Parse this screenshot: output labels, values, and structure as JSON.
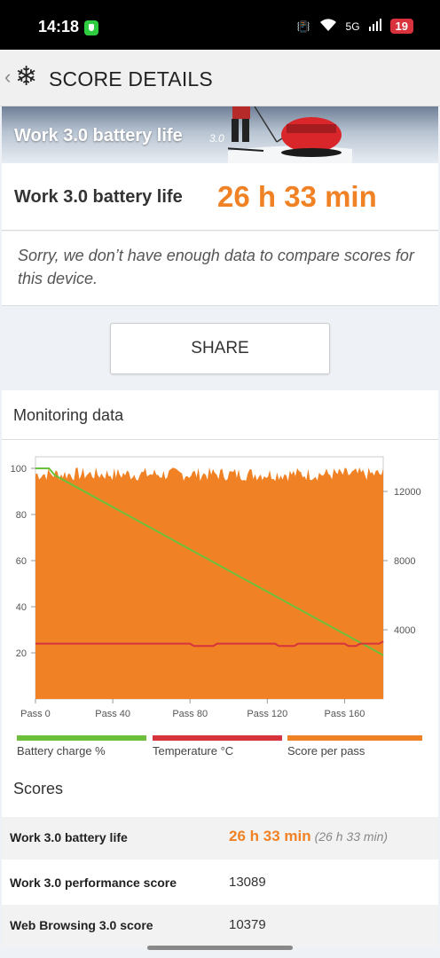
{
  "status_bar": {
    "time": "14:18",
    "signal_label": "5G",
    "battery": "19"
  },
  "header": {
    "title": "SCORE DETAILS"
  },
  "banner": {
    "title": "Work 3.0 battery life",
    "version": "3.0"
  },
  "score": {
    "label": "Work 3.0 battery life",
    "value": "26 h 33 min"
  },
  "notice": {
    "text": "Sorry, we don’t have enough data to compare scores for this device."
  },
  "share_button": {
    "label": "SHARE"
  },
  "monitoring": {
    "title": "Monitoring data"
  },
  "chart_data": {
    "type": "area",
    "x_ticks": [
      "Pass 0",
      "Pass 40",
      "Pass 80",
      "Pass 120",
      "Pass 160"
    ],
    "x_range": [
      0,
      180
    ],
    "left_axis": {
      "ticks": [
        20,
        40,
        60,
        80,
        100
      ],
      "range": [
        0,
        105
      ]
    },
    "right_axis": {
      "ticks": [
        4000,
        8000,
        12000
      ],
      "range": [
        0,
        14000
      ]
    },
    "series": [
      {
        "name": "Battery charge %",
        "color": "#6cbf3b",
        "axis": "left",
        "x": [
          0,
          7,
          10,
          180
        ],
        "y": [
          100,
          100,
          97,
          19
        ]
      },
      {
        "name": "Temperature °C",
        "color": "#d6333d",
        "axis": "left",
        "x": [
          0,
          80,
          82,
          92,
          94,
          104,
          106,
          124,
          126,
          134,
          136,
          160,
          162,
          166,
          168,
          178,
          180
        ],
        "y": [
          24,
          24,
          23,
          23,
          24,
          24,
          24,
          24,
          23,
          23,
          24,
          24,
          23,
          23,
          24,
          24,
          25
        ]
      },
      {
        "name": "Score per pass",
        "color": "#f08225",
        "axis": "right",
        "x_range": [
          0,
          180
        ],
        "mean": 12900,
        "min": 12600,
        "max": 13400
      }
    ]
  },
  "legend": [
    {
      "label": "Battery charge %",
      "color": "#6cbf3b"
    },
    {
      "label": "Temperature °C",
      "color": "#d6333d"
    },
    {
      "label": "Score per pass",
      "color": "#f08225"
    }
  ],
  "scores": {
    "title": "Scores",
    "rows": [
      {
        "name": "Work 3.0 battery life",
        "value": "26 h 33 min",
        "sub": "(26 h 33 min)"
      },
      {
        "name": "Work 3.0 performance score",
        "value": "13089"
      },
      {
        "name": "Web Browsing 3.0 score",
        "value": "10379"
      }
    ]
  }
}
